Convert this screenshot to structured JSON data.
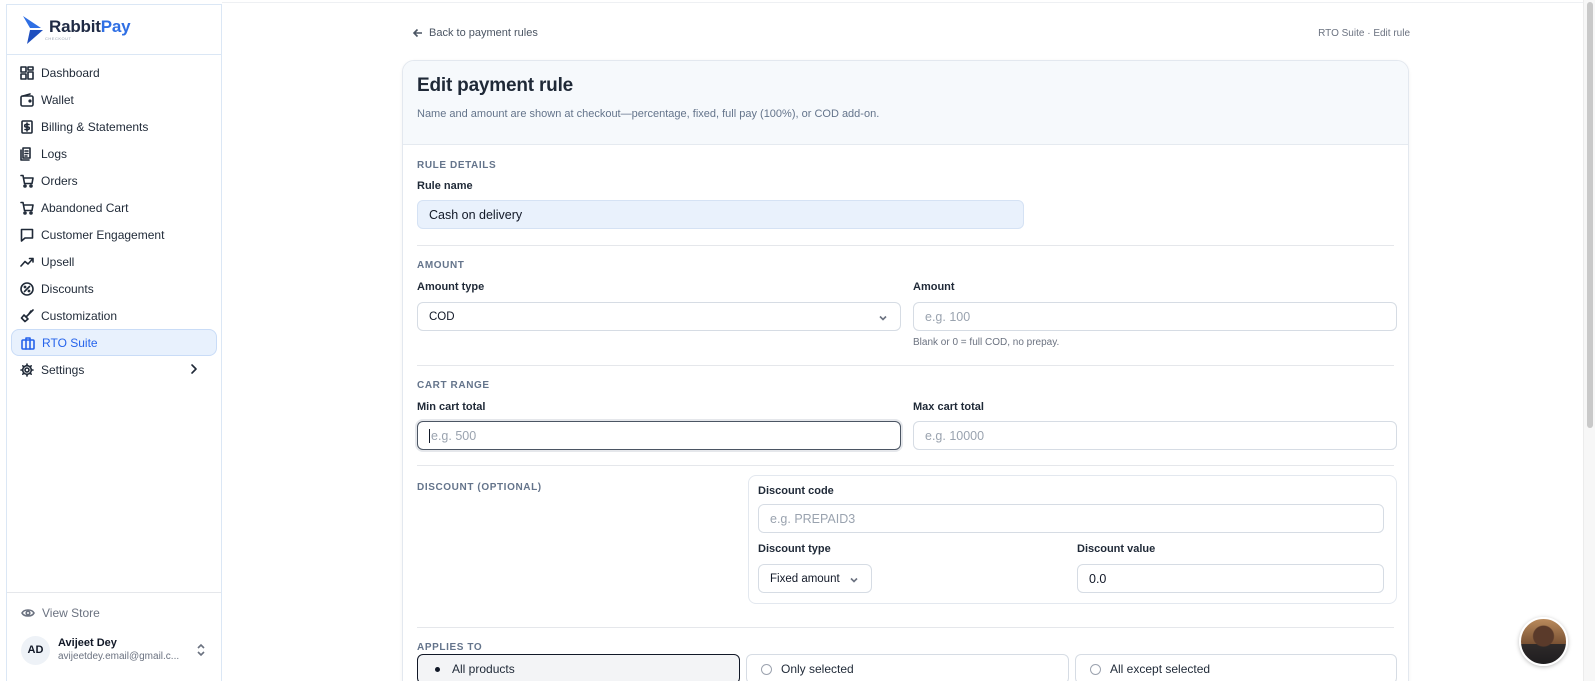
{
  "brand": {
    "name_part1": "Rabbit",
    "name_part2": "Pay",
    "tagline": "CHECKOUT",
    "brand_color": "#2f6fe4"
  },
  "sidebar": {
    "items": [
      {
        "label": "Dashboard",
        "icon": "dashboard-icon"
      },
      {
        "label": "Wallet",
        "icon": "wallet-icon"
      },
      {
        "label": "Billing & Statements",
        "icon": "receipt-icon"
      },
      {
        "label": "Logs",
        "icon": "logs-icon"
      },
      {
        "label": "Orders",
        "icon": "cart-icon"
      },
      {
        "label": "Abandoned Cart",
        "icon": "cart-icon"
      },
      {
        "label": "Customer Engagement",
        "icon": "message-icon"
      },
      {
        "label": "Upsell",
        "icon": "trending-up-icon"
      },
      {
        "label": "Discounts",
        "icon": "discount-icon"
      },
      {
        "label": "Customization",
        "icon": "brush-icon"
      },
      {
        "label": "RTO Suite",
        "icon": "briefcase-icon",
        "active": true
      },
      {
        "label": "Settings",
        "icon": "gear-icon"
      }
    ],
    "view_store": "View Store",
    "user": {
      "initials": "AD",
      "name": "Avijeet Dey",
      "email": "avijeetdey.email@gmail.c..."
    }
  },
  "header": {
    "back_label": "Back to payment rules",
    "breadcrumb": "RTO Suite · Edit rule"
  },
  "card": {
    "title": "Edit payment rule",
    "subtitle": "Name and amount are shown at checkout—percentage, fixed, full pay (100%), or COD add-on."
  },
  "rule_details": {
    "section": "RULE DETAILS",
    "name_label": "Rule name",
    "name_value": "Cash on delivery"
  },
  "amount": {
    "section": "AMOUNT",
    "type_label": "Amount type",
    "type_value": "COD",
    "amount_label": "Amount",
    "amount_placeholder": "e.g. 100",
    "hint": "Blank or 0 = full COD, no prepay."
  },
  "cart_range": {
    "section": "CART RANGE",
    "min_label": "Min cart total",
    "min_placeholder": "e.g. 500",
    "max_label": "Max cart total",
    "max_placeholder": "e.g. 10000"
  },
  "discount": {
    "section": "DISCOUNT (OPTIONAL)",
    "code_label": "Discount code",
    "code_placeholder": "e.g. PREPAID3",
    "type_label": "Discount type",
    "type_value": "Fixed amount",
    "value_label": "Discount value",
    "value": "0.0"
  },
  "applies_to": {
    "section": "APPLIES TO",
    "options": [
      "All products",
      "Only selected",
      "All except selected"
    ],
    "selected": "All products"
  }
}
